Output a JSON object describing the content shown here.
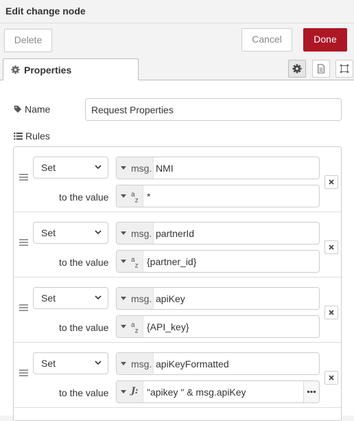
{
  "dialog": {
    "title": "Edit change node"
  },
  "toolbar": {
    "delete_label": "Delete",
    "cancel_label": "Cancel",
    "done_label": "Done"
  },
  "tabs": {
    "properties_label": "Properties"
  },
  "form": {
    "name_label": "Name",
    "name_value": "Request Properties",
    "rules_label": "Rules",
    "to_the_value_label": "to the value"
  },
  "rules": [
    {
      "action": "Set",
      "property_type": "msg.",
      "property": "NMI",
      "value_type": "string",
      "value": "*"
    },
    {
      "action": "Set",
      "property_type": "msg.",
      "property": "partnerId",
      "value_type": "string",
      "value": "{partner_id}"
    },
    {
      "action": "Set",
      "property_type": "msg.",
      "property": "apiKey",
      "value_type": "string",
      "value": "{API_key}"
    },
    {
      "action": "Set",
      "property_type": "msg.",
      "property": "apiKeyFormatted",
      "value_type": "jsonata",
      "value": "\"apikey \" & msg.apiKey"
    }
  ],
  "colors": {
    "accent": "#ad1625",
    "border": "#cccccc",
    "background": "#f3f3f3"
  },
  "icons": [
    "gear-icon",
    "document-icon",
    "frame-icon",
    "tag-icon",
    "list-icon",
    "drag-handle-icon",
    "chevron-down-icon",
    "caret-down-icon",
    "string-type-icon",
    "jsonata-type-icon",
    "ellipsis-icon",
    "close-icon"
  ]
}
